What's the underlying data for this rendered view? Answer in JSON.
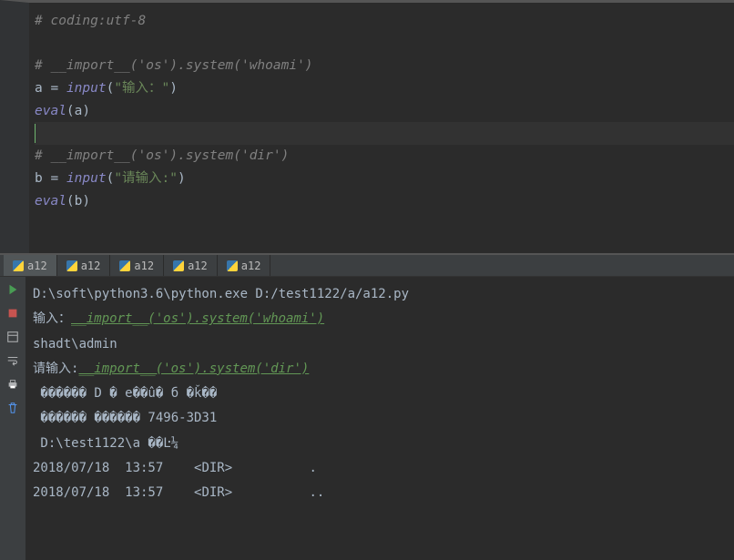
{
  "code": {
    "l1_comment": "# coding:utf-8",
    "l3_comment": "# __import__('os').system('whoami')",
    "l4_var": "a",
    "l4_eq": " = ",
    "l4_fn": "input",
    "l4_str": "\"输入：\"",
    "l5_fn": "eval",
    "l5_arg": "a",
    "l7_comment": "# __import__('os').system('dir')",
    "l8_var": "b",
    "l8_eq": " = ",
    "l8_fn": "input",
    "l8_str": "\"请输入:\"",
    "l9_fn": "eval",
    "l9_arg": "b"
  },
  "tabs": [
    {
      "label": "a12"
    },
    {
      "label": "a12"
    },
    {
      "label": "a12"
    },
    {
      "label": "a12"
    },
    {
      "label": "a12"
    }
  ],
  "console": {
    "cmd": "D:\\soft\\python3.6\\python.exe D:/test1122/a/a12.py",
    "prompt1_label": "输入：",
    "prompt1_input": "__import__('os').system('whoami')",
    "whoami_result": "shadt\\admin",
    "prompt2_label": "请输入:",
    "prompt2_input": "__import__('os').system('dir')",
    "dir_line1": " ������ D � e��û� б �ǩ��",
    "dir_line2": " ������ ������ 7496-3D31",
    "dir_path": " D:\\test1122\\a ��Ŀ¼",
    "entry1_date": "2018/07/18  13:57",
    "entry1_dir": "    <DIR>          .",
    "entry2_date": "2018/07/18  13:57",
    "entry2_dir": "    <DIR>          .."
  },
  "icons": {
    "play": "play-icon",
    "stop": "stop-icon",
    "layout": "layout-icon",
    "print": "print-icon",
    "trash": "trash-icon"
  }
}
